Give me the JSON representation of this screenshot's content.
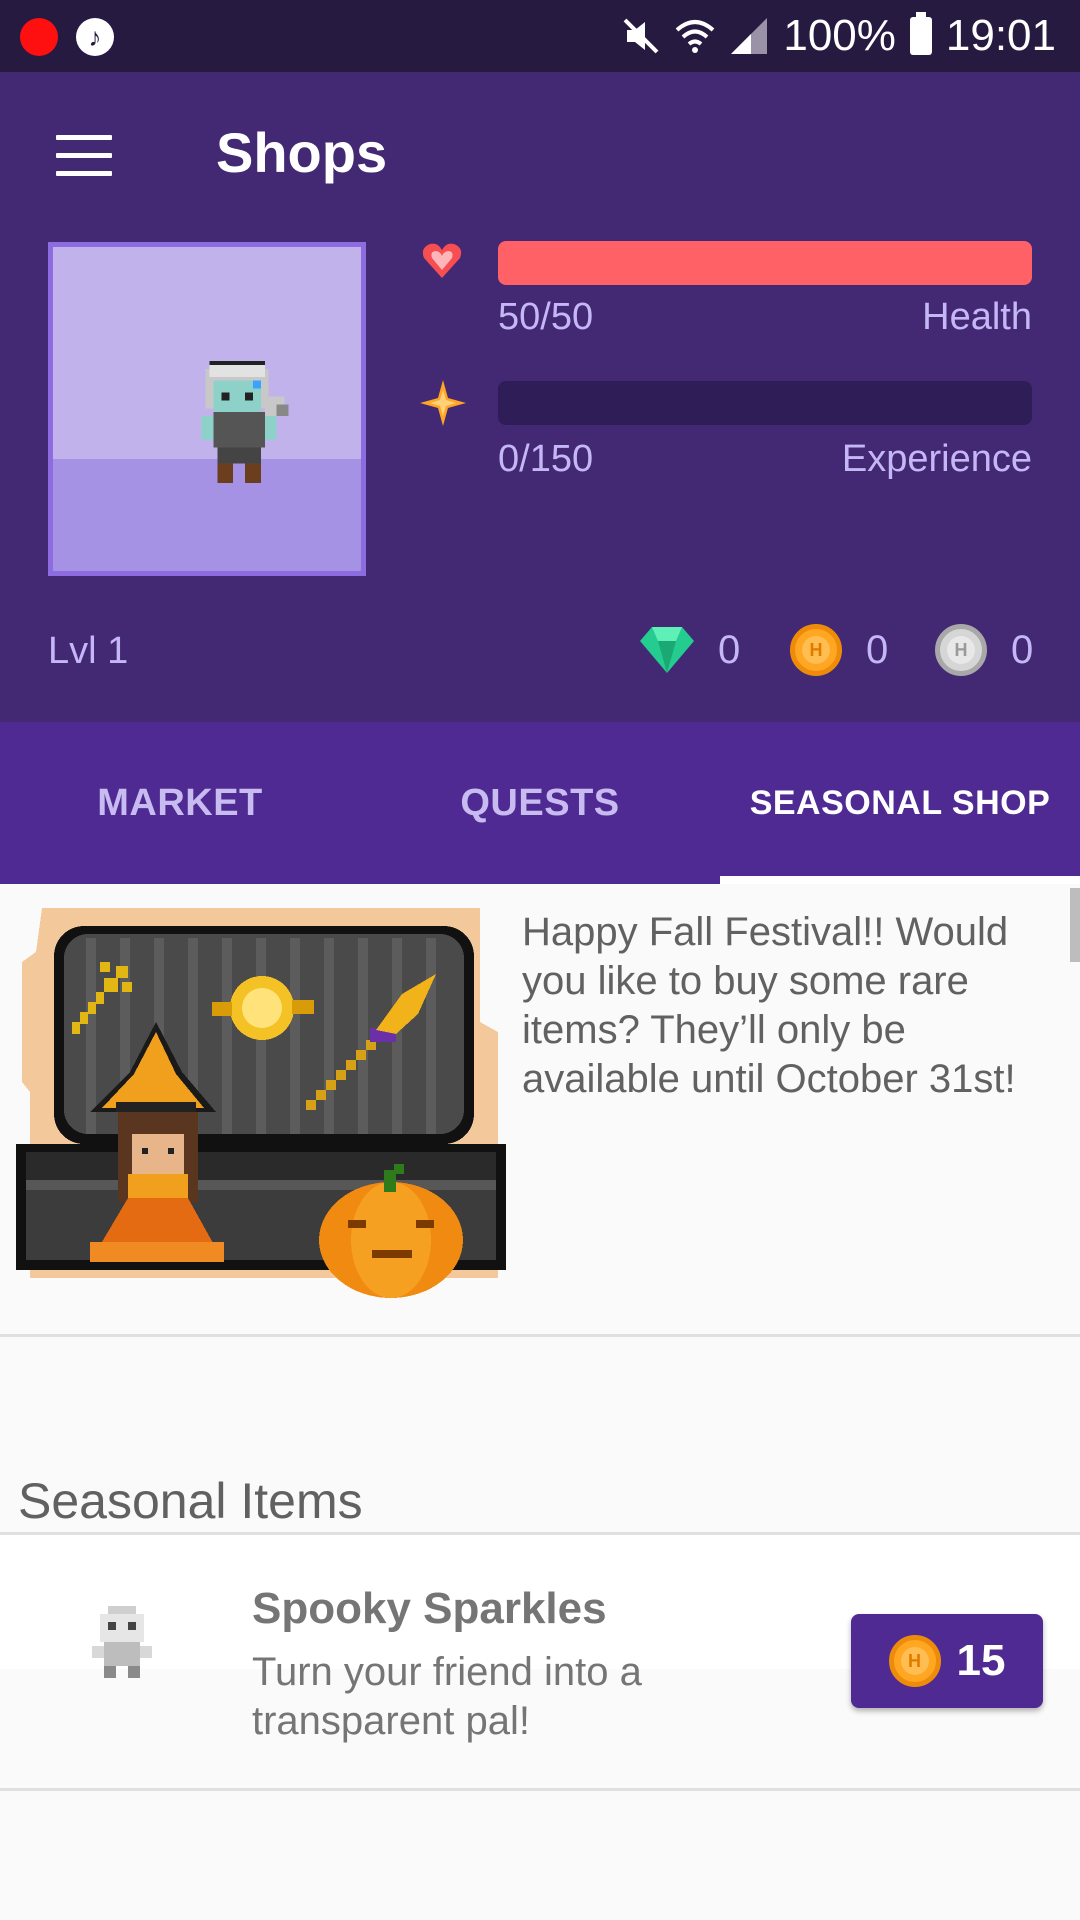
{
  "statusbar": {
    "battery": "100%",
    "time": "19:01"
  },
  "header": {
    "title": "Shops",
    "health": {
      "value": "50/50",
      "label": "Health",
      "fraction": 1.0
    },
    "experience": {
      "value": "0/150",
      "label": "Experience",
      "fraction": 0.0
    },
    "level": "Lvl 1",
    "currencies": {
      "gems": "0",
      "gold": "0",
      "hourglasses": "0"
    }
  },
  "tabs": [
    {
      "label": "MARKET"
    },
    {
      "label": "QUESTS"
    },
    {
      "label": "SEASONAL SHOP",
      "active": true
    }
  ],
  "banner": {
    "text": "Happy Fall Festival!! Would you like to buy some rare items? They’ll only be available until October 31st!"
  },
  "section": {
    "title": "Seasonal Items"
  },
  "items": [
    {
      "name": "Spooky Sparkles",
      "description": "Turn your friend into a transparent pal!",
      "price": "15",
      "currency_icon": "gold-coin-icon"
    }
  ],
  "colors": {
    "header_bg": "#432874",
    "tab_bg": "#4f2a93",
    "health": "#ff6166",
    "statusbar": "#271a41"
  }
}
